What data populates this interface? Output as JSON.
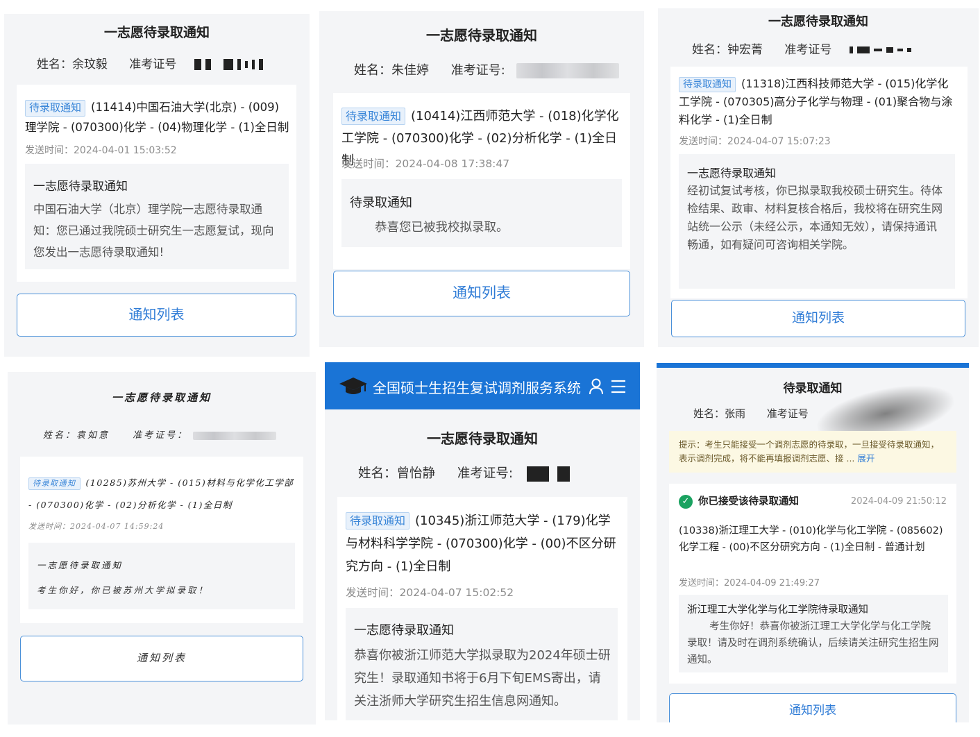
{
  "panels": [
    {
      "title": "一志愿待录取通知",
      "name_label": "姓名：余玟毅",
      "exam_label": "准考证号",
      "card": {
        "tag": "待录取通知",
        "program": "(11414)中国石油大学(北京) - (009)理学院 - (070300)化学 - (04)物理化学 - (1)全日制",
        "sent": "发送时间：2024-04-01 15:03:52",
        "msg_title": "一志愿待录取通知",
        "msg_body": "中国石油大学（北京）理学院一志愿待录取通知：您已通过我院硕士研究生一志愿复试，现向您发出一志愿待录取通知!"
      },
      "button": "通知列表"
    },
    {
      "title": "一志愿待录取通知",
      "name_label": "姓名：朱佳婷",
      "exam_label": "准考证号:",
      "card": {
        "tag": "待录取通知",
        "program": "(10414)江西师范大学 - (018)化学化工学院 - (070300)化学 - (02)分析化学 - (1)全日制",
        "sent": "发送时间：2024-04-08 17:38:47",
        "msg_title": "待录取通知",
        "msg_body": "恭喜您已被我校拟录取。"
      },
      "button": "通知列表"
    },
    {
      "title": "一志愿待录取通知",
      "name_label": "姓名：钟宏菁",
      "exam_label": "准考证号",
      "card": {
        "tag": "待录取通知",
        "program": "(11318)江西科技师范大学 - (015)化学化工学院 - (070305)高分子化学与物理 - (01)聚合物与涂料化学 - (1)全日制",
        "sent": "发送时间：2024-04-07 15:07:23",
        "msg_title": "一志愿待录取通知",
        "msg_body": "经初试复试考核，你已拟录取我校硕士研究生。待体检结果、政审、材料复核合格后，我校将在研究生网站统一公示（未经公示，本通知无效），请保持通讯畅通，如有疑问可咨询相关学院。"
      },
      "button": "通知列表"
    },
    {
      "title": "一志愿待录取通知",
      "name_label": "姓名：袁如意",
      "exam_label": "准考证号：",
      "card": {
        "tag": "待录取通知",
        "program": "(10285)苏州大学 - (015)材料与化学化工学部 - (070300)化学 - (02)分析化学 - (1)全日制",
        "sent": "发送时间：2024-04-07 14:59:24",
        "msg_title": "一志愿待录取通知",
        "msg_body": "考生你好，你已被苏州大学拟录取！"
      },
      "button": "通知列表"
    },
    {
      "app_title": "全国硕士生招生复试调剂服务系统",
      "title": "一志愿待录取通知",
      "name_label": "姓名：曾怡静",
      "exam_label": "准考证号:",
      "card": {
        "tag": "待录取通知",
        "program": "(10345)浙江师范大学 - (179)化学与材料科学学院 - (070300)化学 - (00)不区分研究方向 - (1)全日制",
        "sent": "发送时间：2024-04-07 15:02:52",
        "msg_title": "一志愿待录取通知",
        "msg_body": "恭喜你被浙江师范大学拟录取为2024年硕士研究生！录取通知书将于6月下旬EMS寄出，请关注浙师大学研究生招生信息网通知。"
      }
    },
    {
      "title": "待录取通知",
      "name_label": "姓名：张雨",
      "exam_label": "准考证号",
      "tip": "提示：考生只能接受一个调剂志愿的待录取，一旦接受待录取通知，表示调剂完成，将不能再填报调剂志愿、接 ...",
      "tip_expand": "展开",
      "card": {
        "accepted": "你已接受该待录取通知",
        "accepted_time": "2024-04-09 21:50:12",
        "program": "(10338)浙江理工大学 - (010)化学与化工学院 - (085602)化学工程 - (00)不区分研究方向 - (1)全日制 - 普通计划",
        "sent": "发送时间：2024-04-09 21:49:27",
        "msg_title": "浙江理工大学化学与化工学院待录取通知",
        "msg_body": "考生你好！恭喜你被浙江理工大学化学与化工学院录取！请及时在调剂系统确认，后续请关注研究生招生网通知。"
      },
      "button": "通知列表"
    }
  ],
  "colors": {
    "accent": "#2e7bd6",
    "topbar": "#1a74d6",
    "success": "#1aa260"
  }
}
